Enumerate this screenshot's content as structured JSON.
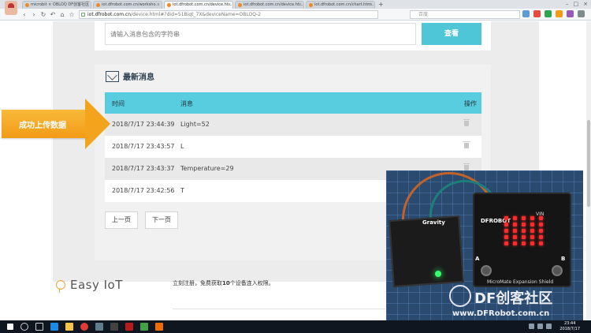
{
  "browser": {
    "tabs": [
      {
        "label": "microbit × OBLOQ DF创客社区"
      },
      {
        "label": "iot.dfrobot.com.cn/worksho..."
      },
      {
        "label": "iot.dfrobot.com.cn/device.ht..."
      },
      {
        "label": "iot.dfrobot.com.cn/device.ht..."
      },
      {
        "label": "iot.dfrobot.com.cn/chart.htm..."
      }
    ],
    "new_tab": "+",
    "url_domain": "iot.dfrobot.com.cn",
    "url_path": "/device.html#?did=51Biqt_7X&deviceName=OBLOQ-2",
    "search_engine": "百度"
  },
  "search": {
    "placeholder": "请输入消息包含的字符串",
    "button_label": "查看"
  },
  "messages": {
    "title": "最新消息",
    "columns": {
      "time": "时间",
      "message": "消息",
      "action": "操作"
    },
    "rows": [
      {
        "time": "2018/7/17 23:44:39",
        "message": "Light=52"
      },
      {
        "time": "2018/7/17 23:43:57",
        "message": "L"
      },
      {
        "time": "2018/7/17 23:43:37",
        "message": "Temperature=29"
      },
      {
        "time": "2018/7/17 23:42:56",
        "message": "T"
      }
    ],
    "prev_label": "上一页",
    "next_label": "下一页"
  },
  "callout": {
    "text": "成功上传数据"
  },
  "footer": {
    "brand": "Easy IoT",
    "text_before": "立刻注册，免费获取",
    "text_count": "10",
    "text_after": "个设备连入权限。"
  },
  "video": {
    "gravity_label": "Gravity",
    "dfrobot_label": "DFROBOT",
    "board_label": "MicroMate Expansion Shield",
    "button_a": "A",
    "button_b": "B",
    "vin_label": "VIN",
    "watermark": "DF创客社区",
    "watermark_url": "www.DFRobot.com.cn"
  },
  "taskbar": {
    "time": "23:44",
    "date": "2018/7/17"
  },
  "colors": {
    "accent": "#4fc6d8",
    "table_header": "#58cddf",
    "callout": "#f4a31d",
    "brand_orange": "#f0a33b"
  }
}
